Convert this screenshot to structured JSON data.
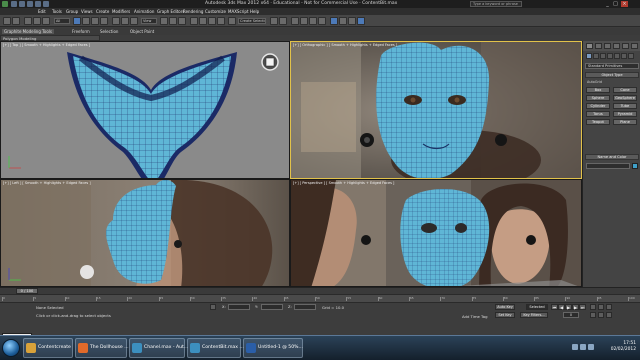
{
  "window": {
    "title": "Autodesk 3ds Max 2012 x64 · Educational - Not for Commercial Use · ContentBit.max",
    "search_placeholder": "Type a keyword or phrase"
  },
  "menu": [
    "Edit",
    "Tools",
    "Group",
    "Views",
    "Create",
    "Modifiers",
    "Animation",
    "Graph Editors",
    "Rendering",
    "Customize",
    "MAXScript",
    "Help"
  ],
  "toolbar": {
    "selection_filter": "All",
    "view_select": "View",
    "named_selection": "Create Selection Se"
  },
  "ribbon": {
    "tabs": [
      "Graphite Modeling Tools",
      "Freeform",
      "Selection",
      "Object Paint"
    ],
    "sub_label": "Polygon Modeling"
  },
  "viewports": {
    "top": "[+] [ Top ] [ Smooth + Highlights + Edged Faces ]",
    "front": "[+] [ Orthographic ] [ Smooth + Highlights + Edged Faces ]",
    "left": "[+] [ Left ] [ Smooth + Highlights + Edged Faces ]",
    "perspective": "[+] [ Perspective ] [ Smooth + Highlights + Edged Faces ]"
  },
  "command_panel": {
    "category": "Standard Primitives",
    "object_type_header": "Object Type",
    "autogrid_label": "AutoGrid",
    "objects": [
      "Box",
      "Cone",
      "Sphere",
      "GeoSphere",
      "Cylinder",
      "Tube",
      "Torus",
      "Pyramid",
      "Teapot",
      "Plane"
    ],
    "name_color_header": "Name and Color"
  },
  "timeline": {
    "frame": "0 / 100",
    "ticks": [
      "0",
      "5",
      "10",
      "15",
      "20",
      "25",
      "30",
      "35",
      "40",
      "45",
      "50",
      "55",
      "60",
      "65",
      "70",
      "75",
      "80",
      "85",
      "90",
      "95",
      "100"
    ]
  },
  "status": {
    "selection": "None Selected",
    "prompt": "Click or click-and-drag to select objects",
    "welcome": "Welcome to M",
    "x_label": "X:",
    "y_label": "Y:",
    "z_label": "Z:",
    "grid": "Grid = 10.0",
    "auto_key": "Auto Key",
    "set_key": "Set Key",
    "key_mode": "Selected",
    "key_filters": "Key Filters...",
    "add_time_tag": "Add Time Tag",
    "frame_field": "0"
  },
  "taskbar": {
    "items": [
      {
        "label": "Contentcreate",
        "color": "#d8a23a"
      },
      {
        "label": "The Dollhouse ...",
        "color": "#e06a2a"
      },
      {
        "label": "Chanel.max - Aut...",
        "color": "#3c8fbf"
      },
      {
        "label": "ContentBit.max ...",
        "color": "#3c8fbf"
      },
      {
        "label": "Untitled-1 @ 50%...",
        "color": "#2a5ea8"
      }
    ],
    "time": "17:51",
    "date": "02/02/2012"
  },
  "colors": {
    "mesh": "#5fb6d6",
    "active_viewport": "#e2c24a"
  }
}
